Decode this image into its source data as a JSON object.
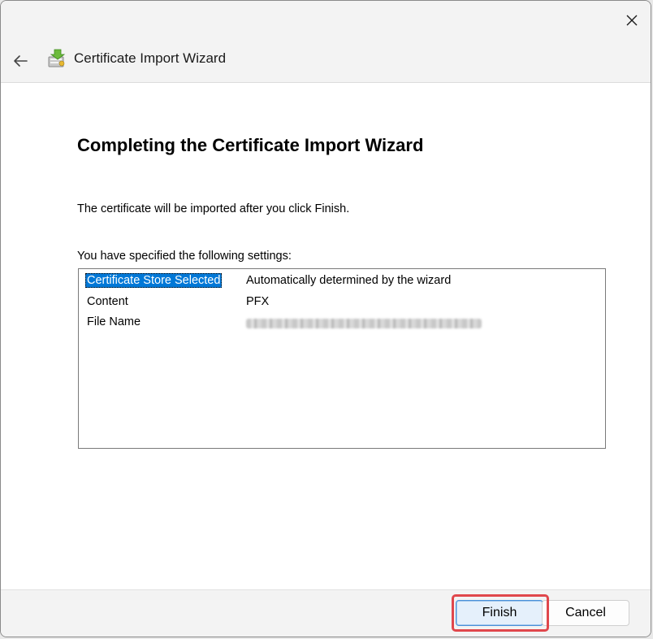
{
  "window": {
    "close_label": "✕"
  },
  "header": {
    "title": "Certificate Import Wizard"
  },
  "main": {
    "heading": "Completing the Certificate Import Wizard",
    "description": "The certificate will be imported after you click Finish.",
    "settings_label": "You have specified the following settings:",
    "settings": [
      {
        "key": "Certificate Store Selected",
        "value": "Automatically determined by the wizard",
        "selected": true
      },
      {
        "key": "Content",
        "value": "PFX"
      },
      {
        "key": "File Name",
        "value": "",
        "redacted": true
      }
    ]
  },
  "footer": {
    "finish_label": "Finish",
    "cancel_label": "Cancel"
  },
  "colors": {
    "selection": "#0078d7",
    "highlight": "#e0474c",
    "finish_border": "#4a90d9"
  },
  "icons": {
    "close": "close-icon",
    "back": "back-arrow-icon",
    "wizard": "certificate-wizard-icon"
  }
}
